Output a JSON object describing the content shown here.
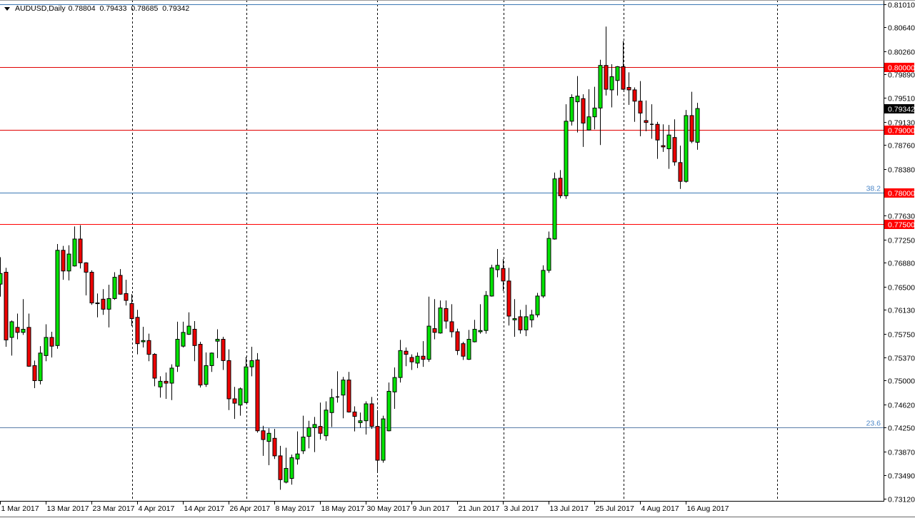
{
  "header": {
    "symbol": "AUDUSD,Daily",
    "open": "0.78804",
    "high": "0.79433",
    "low": "0.78685",
    "close": "0.79342"
  },
  "chart_data": {
    "type": "candlestick",
    "title": "AUDUSD,Daily",
    "ylim": [
      0.7312,
      0.8101
    ],
    "y_ticks": [
      "0.81010",
      "0.80640",
      "0.80260",
      "0.79890",
      "0.79510",
      "0.79130",
      "0.78760",
      "0.78380",
      "0.77630",
      "0.77250",
      "0.76880",
      "0.76500",
      "0.76130",
      "0.75750",
      "0.75370",
      "0.75000",
      "0.74620",
      "0.74250",
      "0.73870",
      "0.73490",
      "0.73120"
    ],
    "x_ticks": [
      {
        "bar": 0,
        "label": "1 Mar 2017"
      },
      {
        "bar": 8,
        "label": "13 Mar 2017"
      },
      {
        "bar": 16,
        "label": "23 Mar 2017"
      },
      {
        "bar": 24,
        "label": "4 Apr 2017"
      },
      {
        "bar": 32,
        "label": "14 Apr 2017"
      },
      {
        "bar": 40,
        "label": "26 Apr 2017"
      },
      {
        "bar": 48,
        "label": "8 May 2017"
      },
      {
        "bar": 56,
        "label": "18 May 2017"
      },
      {
        "bar": 64,
        "label": "30 May 2017"
      },
      {
        "bar": 72,
        "label": "9 Jun 2017"
      },
      {
        "bar": 80,
        "label": "21 Jun 2017"
      },
      {
        "bar": 88,
        "label": "3 Jul 2017"
      },
      {
        "bar": 96,
        "label": "13 Jul 2017"
      },
      {
        "bar": 104,
        "label": "25 Jul 2017"
      },
      {
        "bar": 112,
        "label": "4 Aug 2017"
      },
      {
        "bar": 120,
        "label": "16 Aug 2017"
      }
    ],
    "levels": [
      {
        "price": 0.8101,
        "color": "#3c78b4",
        "label": "",
        "tag": ""
      },
      {
        "price": 0.8,
        "color": "#e00000",
        "label": "",
        "tag": "0.80000"
      },
      {
        "price": 0.79,
        "color": "#e00000",
        "label": "",
        "tag": "0.79000"
      },
      {
        "price": 0.78,
        "color": "#3c78b4",
        "label": "38.2",
        "tag": "0.78000"
      },
      {
        "price": 0.775,
        "color": "#ff0000",
        "label": "",
        "tag": "0.77500"
      },
      {
        "price": 0.7425,
        "color": "#5a7ea8",
        "label": "23.6",
        "tag": ""
      }
    ],
    "last_price": "0.79342",
    "colors": {
      "bull": "#00e400",
      "bear": "#ee0000",
      "tag_bg": "#ff0000",
      "last_bg": "#000000",
      "fib_text": "#4a86c8"
    },
    "ohlc_fields": [
      "open",
      "high",
      "low",
      "close"
    ],
    "candles": [
      [
        0.7654,
        0.7697,
        0.7634,
        0.7671
      ],
      [
        0.7673,
        0.768,
        0.7554,
        0.7565
      ],
      [
        0.7569,
        0.7596,
        0.754,
        0.7594
      ],
      [
        0.7585,
        0.7607,
        0.7566,
        0.7577
      ],
      [
        0.7577,
        0.763,
        0.7573,
        0.7582
      ],
      [
        0.7585,
        0.7607,
        0.7522,
        0.7523
      ],
      [
        0.7524,
        0.7532,
        0.7488,
        0.75
      ],
      [
        0.75,
        0.7555,
        0.7494,
        0.7544
      ],
      [
        0.754,
        0.759,
        0.7531,
        0.7569
      ],
      [
        0.7569,
        0.7578,
        0.7537,
        0.7555
      ],
      [
        0.7556,
        0.7718,
        0.7551,
        0.7708
      ],
      [
        0.7708,
        0.7715,
        0.7661,
        0.7675
      ],
      [
        0.7675,
        0.7716,
        0.766,
        0.7702
      ],
      [
        0.7683,
        0.7746,
        0.7682,
        0.7726
      ],
      [
        0.7726,
        0.7748,
        0.7679,
        0.7688
      ],
      [
        0.7688,
        0.7689,
        0.7636,
        0.7673
      ],
      [
        0.7673,
        0.7676,
        0.7621,
        0.7624
      ],
      [
        0.7624,
        0.7639,
        0.7601,
        0.7623
      ],
      [
        0.763,
        0.7646,
        0.7605,
        0.7614
      ],
      [
        0.7614,
        0.7653,
        0.7585,
        0.7631
      ],
      [
        0.7631,
        0.7673,
        0.7629,
        0.7665
      ],
      [
        0.7668,
        0.7678,
        0.7637,
        0.7638
      ],
      [
        0.7639,
        0.7661,
        0.762,
        0.7628
      ],
      [
        0.7623,
        0.7638,
        0.7587,
        0.7599
      ],
      [
        0.7601,
        0.7613,
        0.7542,
        0.7559
      ],
      [
        0.7562,
        0.7586,
        0.7553,
        0.7564
      ],
      [
        0.7564,
        0.7575,
        0.7531,
        0.7542
      ],
      [
        0.7542,
        0.7544,
        0.7491,
        0.7504
      ],
      [
        0.749,
        0.7507,
        0.7473,
        0.7499
      ],
      [
        0.7499,
        0.7513,
        0.7471,
        0.7496
      ],
      [
        0.7496,
        0.7526,
        0.7469,
        0.752
      ],
      [
        0.7523,
        0.7594,
        0.7514,
        0.7566
      ],
      [
        0.7555,
        0.7594,
        0.7553,
        0.7577
      ],
      [
        0.7574,
        0.7609,
        0.7573,
        0.7587
      ],
      [
        0.7582,
        0.7595,
        0.7531,
        0.7556
      ],
      [
        0.7558,
        0.7562,
        0.7489,
        0.7493
      ],
      [
        0.7494,
        0.7545,
        0.749,
        0.7524
      ],
      [
        0.7524,
        0.7545,
        0.7514,
        0.7544
      ],
      [
        0.7563,
        0.7582,
        0.7536,
        0.7566
      ],
      [
        0.7566,
        0.757,
        0.7517,
        0.7532
      ],
      [
        0.7532,
        0.755,
        0.7453,
        0.7471
      ],
      [
        0.7471,
        0.749,
        0.7439,
        0.7464
      ],
      [
        0.7461,
        0.7489,
        0.7444,
        0.7487
      ],
      [
        0.7465,
        0.7538,
        0.7464,
        0.7522
      ],
      [
        0.7522,
        0.7554,
        0.7507,
        0.7532
      ],
      [
        0.7533,
        0.7544,
        0.7417,
        0.742
      ],
      [
        0.742,
        0.7428,
        0.738,
        0.7406
      ],
      [
        0.7403,
        0.7424,
        0.7365,
        0.7416
      ],
      [
        0.7408,
        0.7423,
        0.7375,
        0.738
      ],
      [
        0.738,
        0.7396,
        0.7326,
        0.7342
      ],
      [
        0.7338,
        0.7393,
        0.7336,
        0.736
      ],
      [
        0.7344,
        0.7382,
        0.7334,
        0.7377
      ],
      [
        0.7375,
        0.7419,
        0.7366,
        0.7383
      ],
      [
        0.7388,
        0.7444,
        0.7383,
        0.741
      ],
      [
        0.7411,
        0.7436,
        0.7392,
        0.7425
      ],
      [
        0.7425,
        0.7442,
        0.7386,
        0.743
      ],
      [
        0.7427,
        0.7465,
        0.7406,
        0.7416
      ],
      [
        0.7412,
        0.7467,
        0.7404,
        0.7453
      ],
      [
        0.7449,
        0.7487,
        0.7426,
        0.7473
      ],
      [
        0.7474,
        0.7515,
        0.7465,
        0.7474
      ],
      [
        0.7477,
        0.7506,
        0.744,
        0.7501
      ],
      [
        0.7501,
        0.7514,
        0.7449,
        0.745
      ],
      [
        0.745,
        0.7459,
        0.7419,
        0.7443
      ],
      [
        0.7433,
        0.7449,
        0.7425,
        0.7436
      ],
      [
        0.7436,
        0.7467,
        0.7414,
        0.7463
      ],
      [
        0.7463,
        0.7474,
        0.7423,
        0.7427
      ],
      [
        0.7427,
        0.7453,
        0.7355,
        0.7373
      ],
      [
        0.7373,
        0.7444,
        0.7369,
        0.7439
      ],
      [
        0.742,
        0.7497,
        0.7419,
        0.7483
      ],
      [
        0.7482,
        0.7521,
        0.7455,
        0.7505
      ],
      [
        0.7505,
        0.7565,
        0.7497,
        0.7548
      ],
      [
        0.7547,
        0.7553,
        0.7523,
        0.7542
      ],
      [
        0.7537,
        0.7542,
        0.7517,
        0.753
      ],
      [
        0.7528,
        0.7545,
        0.752,
        0.7539
      ],
      [
        0.7539,
        0.7563,
        0.7522,
        0.7534
      ],
      [
        0.7534,
        0.7634,
        0.753,
        0.7587
      ],
      [
        0.7583,
        0.763,
        0.7566,
        0.7577
      ],
      [
        0.7576,
        0.7628,
        0.7575,
        0.7616
      ],
      [
        0.7615,
        0.7628,
        0.7583,
        0.7595
      ],
      [
        0.7594,
        0.7622,
        0.7569,
        0.7578
      ],
      [
        0.7578,
        0.7583,
        0.7541,
        0.7548
      ],
      [
        0.7559,
        0.7562,
        0.7533,
        0.7539
      ],
      [
        0.7534,
        0.7581,
        0.7533,
        0.7566
      ],
      [
        0.7562,
        0.7597,
        0.7561,
        0.7582
      ],
      [
        0.7578,
        0.7622,
        0.7575,
        0.758
      ],
      [
        0.758,
        0.7643,
        0.7575,
        0.7636
      ],
      [
        0.7635,
        0.7685,
        0.7634,
        0.768
      ],
      [
        0.7677,
        0.771,
        0.7665,
        0.7684
      ],
      [
        0.7679,
        0.7694,
        0.7643,
        0.7659
      ],
      [
        0.7659,
        0.768,
        0.7588,
        0.7603
      ],
      [
        0.7597,
        0.763,
        0.757,
        0.7599
      ],
      [
        0.7602,
        0.7613,
        0.7575,
        0.7581
      ],
      [
        0.7581,
        0.7621,
        0.7571,
        0.7602
      ],
      [
        0.7597,
        0.7613,
        0.7585,
        0.7605
      ],
      [
        0.7605,
        0.764,
        0.7601,
        0.7635
      ],
      [
        0.7635,
        0.7684,
        0.7632,
        0.7676
      ],
      [
        0.7676,
        0.7738,
        0.7672,
        0.7727
      ],
      [
        0.7726,
        0.7832,
        0.7725,
        0.7822
      ],
      [
        0.7823,
        0.7836,
        0.7791,
        0.7795
      ],
      [
        0.7795,
        0.7941,
        0.779,
        0.7914
      ],
      [
        0.7914,
        0.7957,
        0.7907,
        0.7952
      ],
      [
        0.7945,
        0.7986,
        0.7896,
        0.7954
      ],
      [
        0.795,
        0.7957,
        0.7873,
        0.7911
      ],
      [
        0.79,
        0.7965,
        0.7899,
        0.7921
      ],
      [
        0.7921,
        0.7969,
        0.7901,
        0.7935
      ],
      [
        0.7935,
        0.8012,
        0.7876,
        0.8003
      ],
      [
        0.8003,
        0.8065,
        0.7955,
        0.7965
      ],
      [
        0.7964,
        0.8005,
        0.7936,
        0.7985
      ],
      [
        0.7979,
        0.8002,
        0.7955,
        0.8001
      ],
      [
        0.8001,
        0.8042,
        0.7964,
        0.7965
      ],
      [
        0.7968,
        0.7992,
        0.794,
        0.7964
      ],
      [
        0.7964,
        0.7968,
        0.7913,
        0.7946
      ],
      [
        0.7946,
        0.7978,
        0.789,
        0.7927
      ],
      [
        0.7915,
        0.7947,
        0.7898,
        0.7912
      ],
      [
        0.7909,
        0.7941,
        0.7886,
        0.7909
      ],
      [
        0.7909,
        0.7913,
        0.7854,
        0.7884
      ],
      [
        0.7875,
        0.7909,
        0.7865,
        0.7873
      ],
      [
        0.787,
        0.7908,
        0.7838,
        0.7892
      ],
      [
        0.7888,
        0.7917,
        0.7843,
        0.7849
      ],
      [
        0.7848,
        0.7875,
        0.7806,
        0.7818
      ],
      [
        0.7818,
        0.7932,
        0.7816,
        0.7923
      ],
      [
        0.7923,
        0.7961,
        0.7879,
        0.7882
      ],
      [
        0.78804,
        0.79433,
        0.78685,
        0.79342
      ]
    ]
  }
}
